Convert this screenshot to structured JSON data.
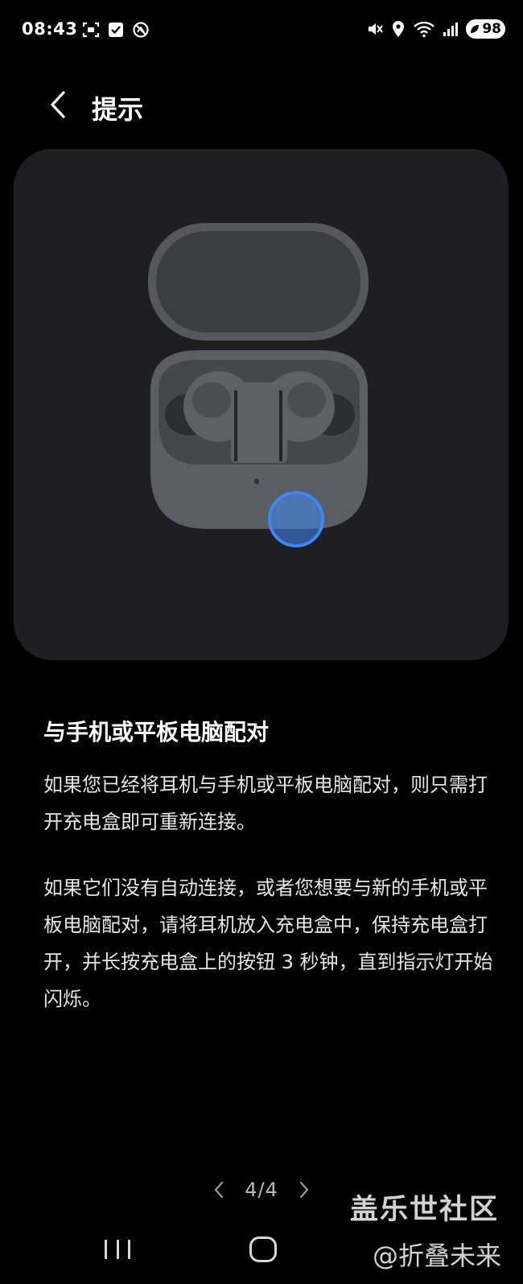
{
  "status_bar": {
    "time": "08:43",
    "left_icons": [
      "screenshot-icon",
      "check-box-icon",
      "no-signal-icon"
    ],
    "right_icons": [
      "mute-icon",
      "location-icon",
      "wifi-icon",
      "signal-icon"
    ],
    "battery_level": "98"
  },
  "header": {
    "back_icon": "chevron-left-icon",
    "title": "提示"
  },
  "illustration": {
    "subject": "earbuds-charging-case-icon",
    "highlight_color": "#3f86f5"
  },
  "content": {
    "heading": "与手机或平板电脑配对",
    "paragraphs": [
      "如果您已经将耳机与手机或平板电脑配对，则只需打开充电盒即可重新连接。",
      "如果它们没有自动连接，或者您想要与新的手机或平板电脑配对，请将耳机放入充电盒中，保持充电盒打开，并长按充电盒上的按钮 3 秒钟，直到指示灯开始闪烁。"
    ]
  },
  "pager": {
    "label": "4/4",
    "prev_icon": "chevron-left-icon",
    "next_icon": "chevron-right-icon"
  },
  "nav_bar": {
    "recents_icon": "recents-icon",
    "home_icon": "home-icon"
  },
  "watermark": {
    "title": "盖乐世社区",
    "subtitle": "@折叠未来"
  },
  "colors": {
    "background": "#000000",
    "card": "#1f1f21",
    "text": "#ffffff",
    "accent": "#3f86f5"
  }
}
